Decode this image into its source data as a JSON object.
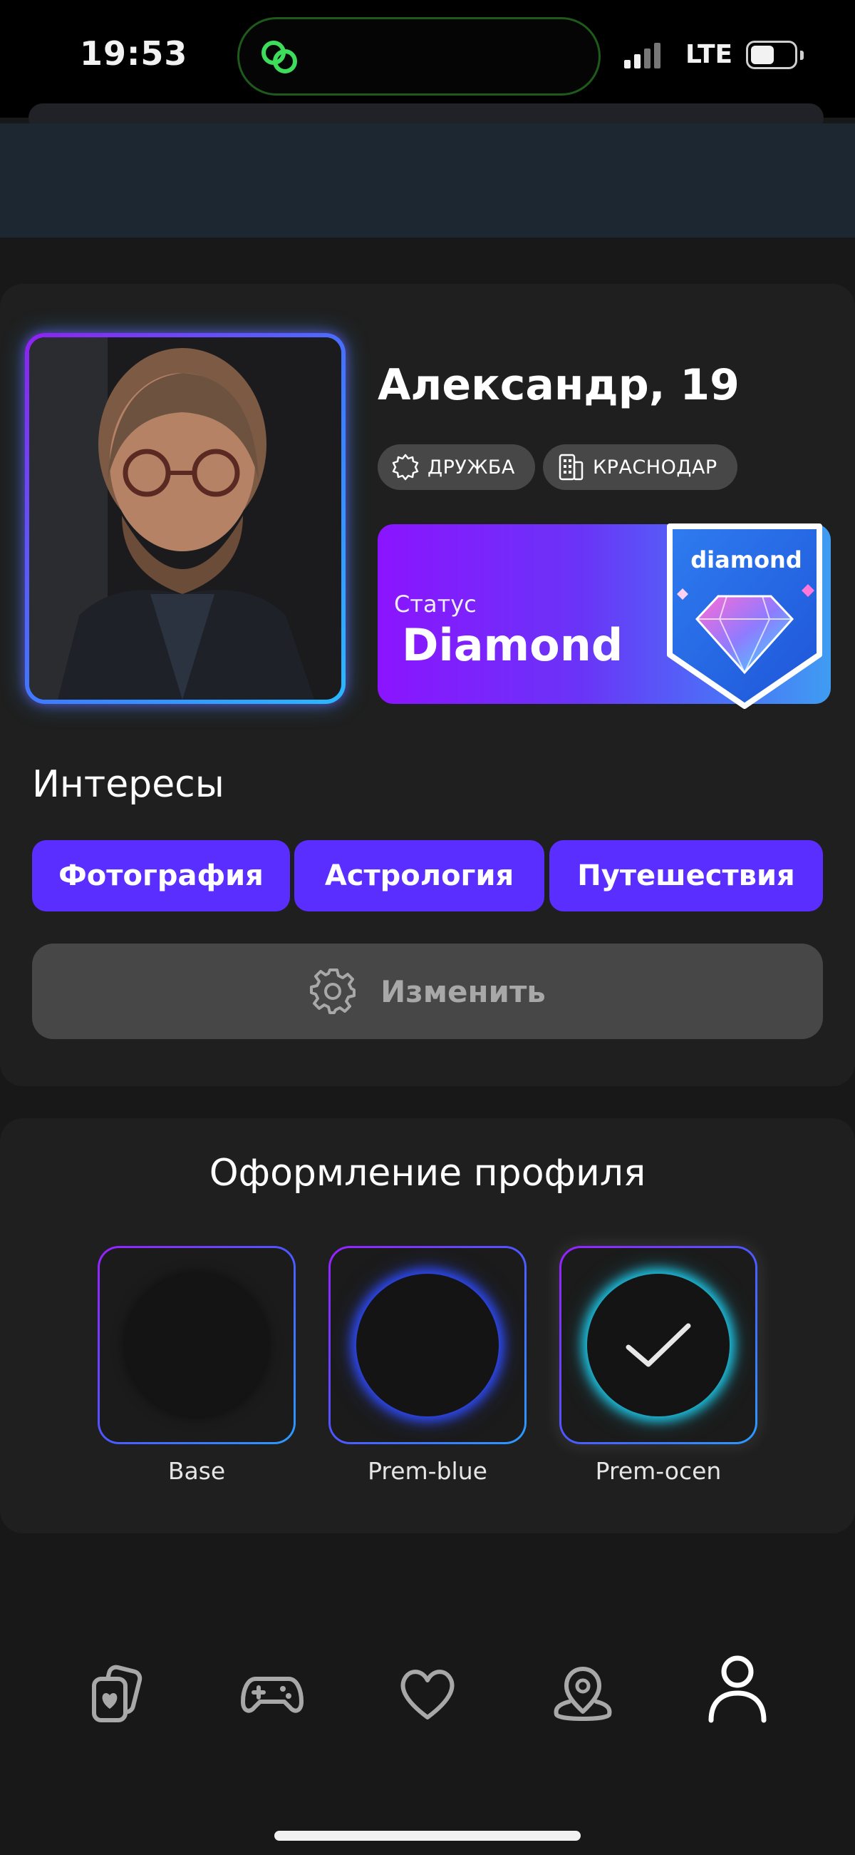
{
  "status_bar": {
    "time": "19:53",
    "network": "LTE"
  },
  "profile": {
    "name": "Александр, 19",
    "chips": [
      {
        "label": "ДРУЖБА",
        "icon": "sun-icon"
      },
      {
        "label": "КРАСНОДАР",
        "icon": "building-icon"
      }
    ],
    "status_label": "Статус",
    "status_value": "Diamond",
    "badge_text": "diamond"
  },
  "interests": {
    "title": "Интересы",
    "tags": [
      "Фотография",
      "Астрология",
      "Путешествия"
    ],
    "edit_label": "Изменить"
  },
  "design": {
    "title": "Оформление профиля",
    "themes": [
      {
        "label": "Base",
        "selected": false
      },
      {
        "label": "Prem-blue",
        "selected": false
      },
      {
        "label": "Prem-ocen",
        "selected": true
      }
    ]
  },
  "tabbar": {
    "items": [
      "cards-heart-icon",
      "gamepad-icon",
      "heart-icon",
      "location-icon",
      "profile-icon"
    ],
    "active": "profile-icon"
  },
  "colors": {
    "accent_purple": "#5a2eff",
    "glow_blue": "#29b9ff",
    "background": "#181818",
    "card": "#1f1f1f"
  }
}
